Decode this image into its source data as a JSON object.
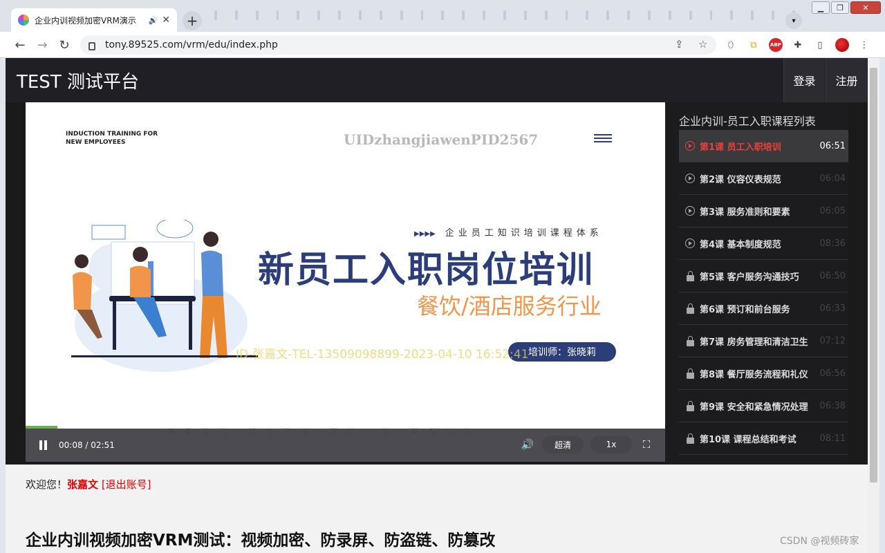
{
  "browser": {
    "tab_title": "企业内训视频加密VRM演示",
    "url": "tony.89525.com/vrm/edu/index.php"
  },
  "header": {
    "brand": "TEST 测试平台",
    "login": "登录",
    "register": "注册"
  },
  "slide": {
    "tag_line1": "INDUCTION TRAINING FOR",
    "tag_line2": "NEW EMPLOYEES",
    "watermark_top": "UIDzhangjiawenPID2567",
    "system": "企业员工知识培训课程体系",
    "title": "新员工入职岗位培训",
    "subtitle": "餐饮/酒店服务行业",
    "trainer": "培训师：张晓莉",
    "watermark_mid": "ID-张嘉文-TEL-13509098899-2023-04-10 16:52:41",
    "motto": "尊重宽容·服务至诚·团结一致·荣辱与共"
  },
  "player": {
    "time": "00:08 / 02:51",
    "progress": 0.05,
    "quality": "超清",
    "speed": "1x"
  },
  "playlist": {
    "title": "企业内训-员工入职课程列表",
    "lessons": [
      {
        "name": "第1课 员工入职培训",
        "dur": "06:51",
        "state": "active"
      },
      {
        "name": "第2课 仪容仪表规范",
        "dur": "06:04",
        "state": "play"
      },
      {
        "name": "第3课 服务准则和要素",
        "dur": "06:05",
        "state": "play"
      },
      {
        "name": "第4课 基本制度规范",
        "dur": "08:36",
        "state": "play"
      },
      {
        "name": "第5课 客户服务沟通技巧",
        "dur": "06:50",
        "state": "lock"
      },
      {
        "name": "第6课 预订和前台服务",
        "dur": "06:33",
        "state": "lock"
      },
      {
        "name": "第7课 房务管理和清洁卫生",
        "dur": "07:12",
        "state": "lock"
      },
      {
        "name": "第8课 餐厅服务流程和礼仪",
        "dur": "06:56",
        "state": "lock"
      },
      {
        "name": "第9课 安全和紧急情况处理",
        "dur": "06:38",
        "state": "lock"
      },
      {
        "name": "第10课 课程总结和考试",
        "dur": "08:11",
        "state": "lock"
      }
    ]
  },
  "welcome": {
    "prefix": "欢迎您！",
    "user": "张嘉文",
    "logout": "[退出账号]"
  },
  "article": {
    "title": "企业内训视频加密VRM测试：视频加密、防录屏、防盗链、防篡改"
  },
  "footer": {
    "csdn": "CSDN @视频砖家"
  },
  "colors": {
    "accent_red": "#e8413b",
    "brand_navy": "#2c3e7a",
    "orange": "#f0954a",
    "header_bg": "#1f1f25"
  }
}
